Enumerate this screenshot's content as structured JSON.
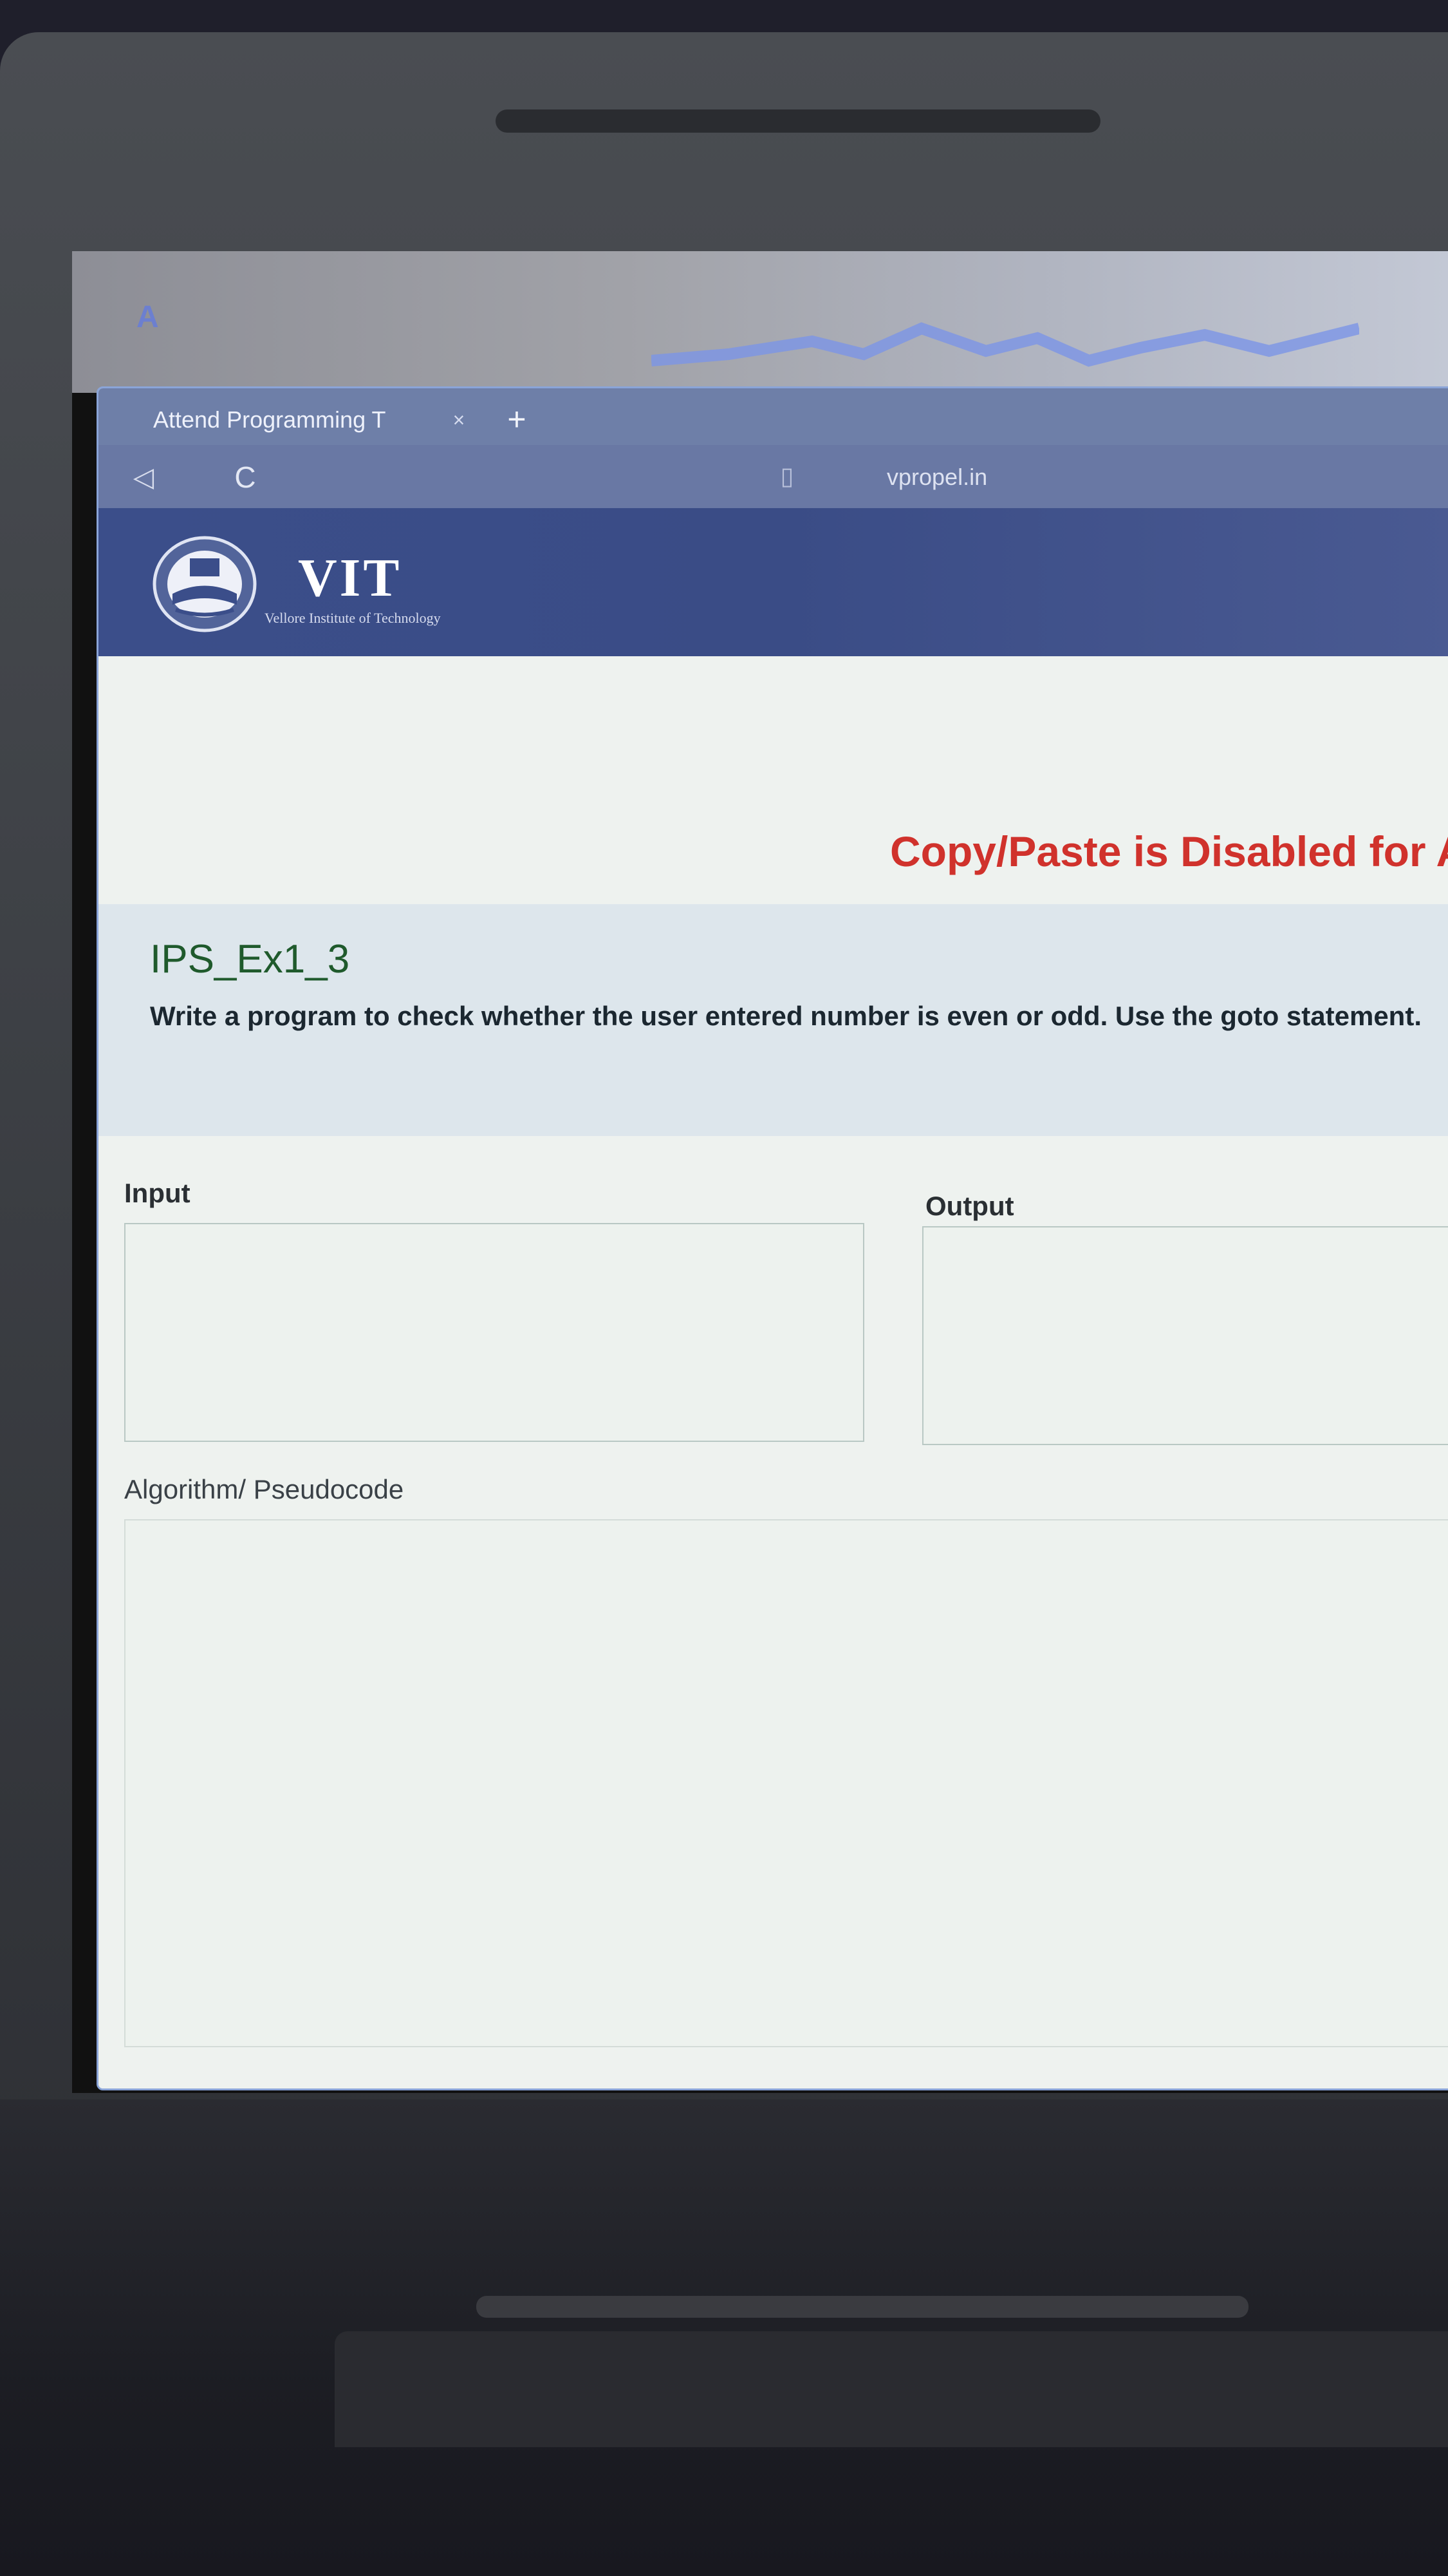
{
  "browser": {
    "tab_title": "Attend Programming T",
    "tab_close": "×",
    "new_tab": "+",
    "back_icon": "◁",
    "reload_icon": "C",
    "url": "vpropel.in"
  },
  "header": {
    "logo_name": "VIT",
    "logo_tagline": "Vellore Institute of Technology"
  },
  "page": {
    "notice": "Copy/Paste is Disabled for Assessr",
    "question_title": "IPS_Ex1_3",
    "question_text": "Write a program to check whether the user entered number is even or odd. Use the goto statement.",
    "input_label": "Input",
    "output_label": "Output",
    "algorithm_label": "Algorithm/ Pseudocode",
    "input_value": "",
    "output_value": "",
    "algorithm_value": ""
  },
  "colors": {
    "notice": "#d0322c",
    "question_title": "#1f5a2c",
    "header_bg": "#3b4e8a"
  }
}
